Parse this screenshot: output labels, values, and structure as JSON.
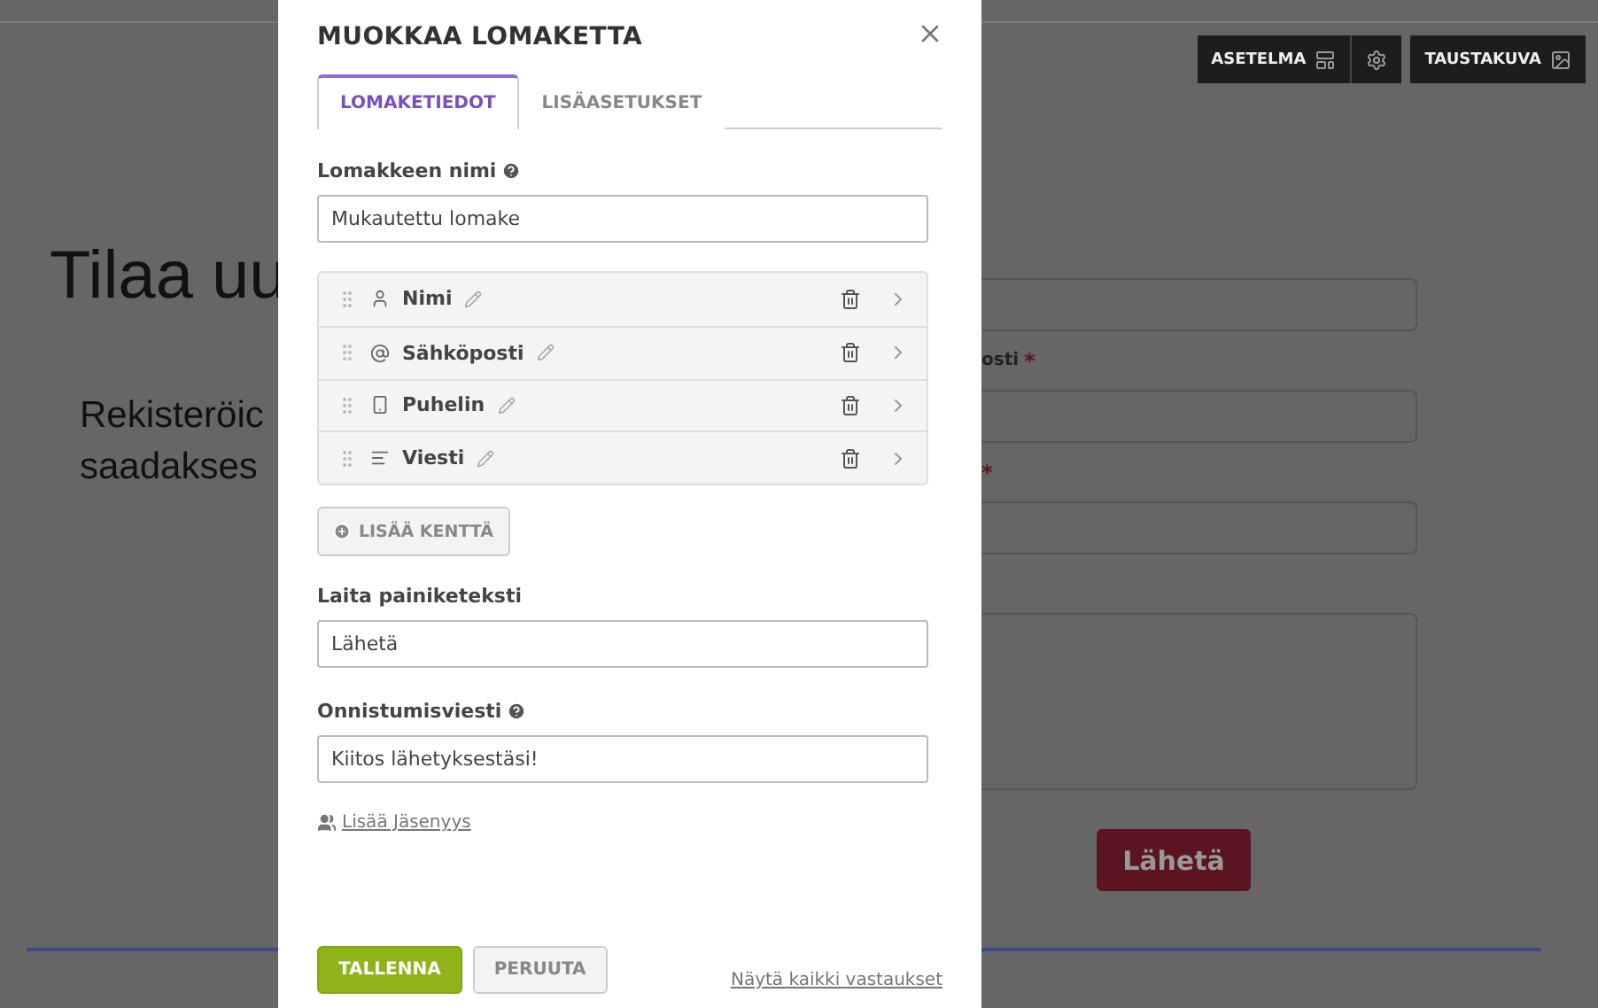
{
  "background": {
    "toolbar": [
      {
        "kind": "layout",
        "label": "ASETELMA"
      },
      {
        "kind": "settings"
      },
      {
        "kind": "image",
        "label": "TAUSTAKUVA"
      }
    ],
    "heading": "Tilaa uu",
    "intro": [
      "Rekisteröic",
      "saadakses"
    ],
    "form_fields": [
      {
        "kind": "input"
      },
      {
        "kind": "input",
        "label": "osti",
        "required_mark": "*"
      },
      {
        "kind": "input",
        "required_mark": "*"
      },
      {
        "kind": "textarea"
      }
    ],
    "submit": "Lähetä"
  },
  "dialog": {
    "title": "MUOKKAA LOMAKETTA",
    "tabs": [
      {
        "label": "LOMAKETIEDOT",
        "selected": true
      },
      {
        "label": "LISÄASETUKSET",
        "selected": false
      }
    ],
    "form_name": {
      "label": "Lomakkeen nimi",
      "help": true,
      "value": "Mukautettu lomake"
    },
    "fields": [
      {
        "kind": "name",
        "label": "Nimi"
      },
      {
        "kind": "email",
        "label": "Sähköposti"
      },
      {
        "kind": "phone",
        "label": "Puhelin"
      },
      {
        "kind": "message",
        "label": "Viesti"
      }
    ],
    "add_field": "LISÄÄ KENTTÄ",
    "button_text": {
      "label": "Laita painiketeksti",
      "help": false,
      "value": "Lähetä"
    },
    "success_message": {
      "label": "Onnistumisviesti",
      "help": true,
      "value": "Kiitos lähetyksestäsi!"
    },
    "membership_link": "Lisää Jäsenyys",
    "save": "TALLENNA",
    "cancel": "PERUUTA",
    "responses_link": "Näytä kaikki vastaukset"
  }
}
